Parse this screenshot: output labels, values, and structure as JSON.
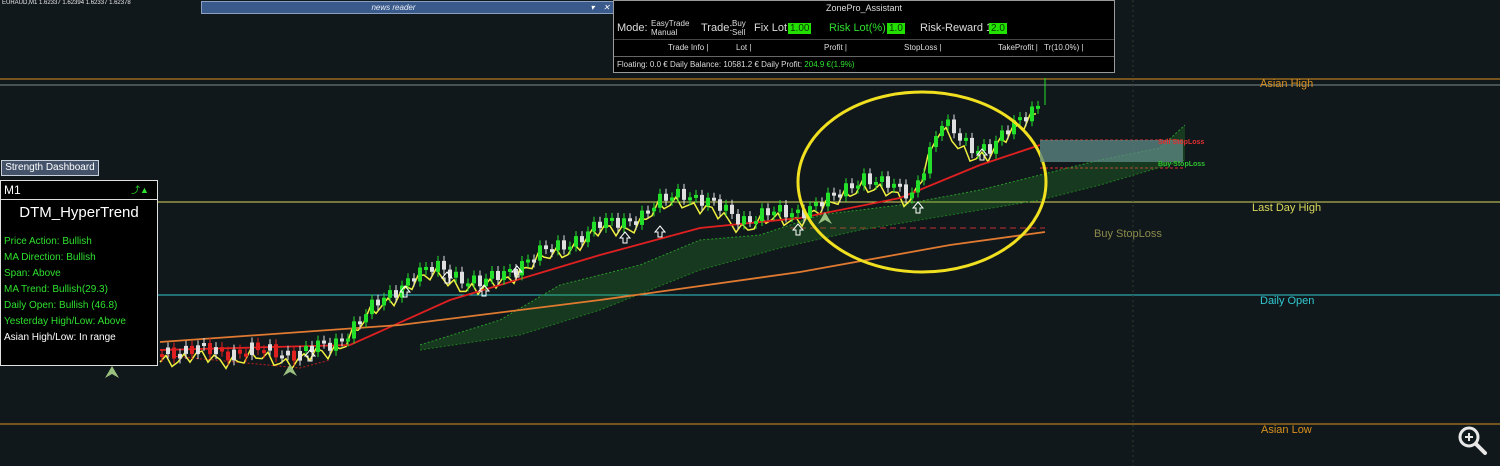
{
  "symbol_info": "EURAUD,M1  1.62337 1.62394 1.62337 1.62378",
  "news_reader": {
    "title": "news reader",
    "minimize_glyph": "▾",
    "close_glyph": "✕"
  },
  "zonepro": {
    "title": "ZonePro_Assistant",
    "mode_label": "Mode:",
    "mode_value_line1": "EasyTrade",
    "mode_value_line2": "Manual",
    "trade_label": "Trade:",
    "trade_value_line1": "Buy",
    "trade_value_line2": "Sell",
    "fixlot_label": "Fix Lot",
    "fixlot_value": "1.00",
    "risklot_label": "Risk Lot(%)",
    "risklot_value": "1.0",
    "rr_label": "Risk-Reward 1 :",
    "rr_value": "2.0",
    "headers": [
      "Trade Info |",
      "Lot |",
      "Profit |",
      "StopLoss |",
      "TakeProfit |",
      "Tr(10.0%) |"
    ],
    "floating_label": "Floating:",
    "floating_value": "0.0 €",
    "daily_balance_label": "Daily Balance:",
    "daily_balance_value": "10581.2 €",
    "daily_profit_label": "Daily Profit:",
    "daily_profit_value": "204.9 €(1.9%)"
  },
  "strength_dashboard": {
    "button_label": "Strength Dashboard",
    "timeframe": "M1",
    "indicator_name": "DTM_HyperTrend",
    "lines": [
      "Price Action: Bullish",
      "MA Direction: Bullish",
      "Span: Above",
      "MA Trend: Bullish(29.3)",
      "Daily Open: Bullish (46.8)",
      "Yesterday High/Low: Above",
      "Asian High/Low: In range"
    ],
    "last_line_color": "#ffffff",
    "line_color": "#2fe02f"
  },
  "levels": {
    "asian_high": "Asian High",
    "last_day_high": "Last Day High",
    "daily_open": "Daily Open",
    "asian_low": "Asian Low",
    "buy_stoploss": "Buy StopLoss",
    "sell_stoploss_small": "Sell StopLoss",
    "buy_stoploss_small": "Buy StopLoss"
  },
  "colors": {
    "background": "#11181c",
    "asian_level": "#d9901e",
    "last_day_high": "#d8d85a",
    "daily_open": "#30c8d0",
    "buy_sl": "#8a8a4a",
    "highlight_circle": "#f0e020",
    "bull_candle": "#22e02a",
    "bear_candle": "#e0e0e0",
    "ma_fast": "#f0f040",
    "ma_mid": "#e02020",
    "ma_slow": "#e07a30",
    "cloud": "#2a9a2a"
  },
  "icons": {
    "zoom": "zoom-magnifier-icon",
    "arrows": "up-arrow-icon"
  }
}
